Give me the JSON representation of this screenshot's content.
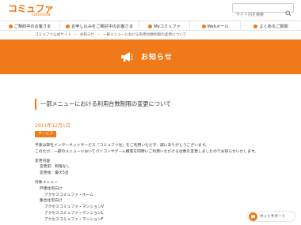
{
  "header": {
    "logo_text": "コミュファ",
    "logo_sub": "commufa",
    "search_placeholder": "サイト内を検索"
  },
  "nav": {
    "items": [
      {
        "label": "ご契約中のお客さま"
      },
      {
        "label": "お申し込みをご検討中のお客さま"
      },
      {
        "label": "Myコミュファ"
      },
      {
        "label": "Webメール"
      },
      {
        "label": "よくあるご質問"
      }
    ]
  },
  "breadcrumb": {
    "items": [
      "コミュファ公式サイト",
      "お知らせ",
      "一部メニューにおける利用台数制限の変更について"
    ]
  },
  "banner": {
    "title": "お知らせ",
    "icon": "megaphone-icon"
  },
  "article": {
    "title": "一部メニューにおける利用台数制限の変更について",
    "date": "2011年12月1日",
    "tag": "サービス",
    "lines": [
      "平素は弊社インターネットサービス「コミュファ光」をご利用いただき、誠にありがとうございます。",
      "このたび、一部のメニューにおいてパソコンやゲーム機等を同時にご利用いただける台数を変更しましたのでお知らせいたします。",
      "",
      "変更内容",
      "変更前：制限なし",
      "変更後：最大5台",
      "",
      "対象メニュー",
      "戸建住宅向け",
      "アクセスコミュファ・ホーム",
      "集合住宅向け",
      "アクセスコミュファ・マンションV",
      "アクセスコミュファ・マンションL",
      "アクセスコミュファ・マンションF"
    ]
  },
  "support": {
    "label": "ネットサポート"
  },
  "colors": {
    "accent": "#f07a1a",
    "text": "#333333"
  }
}
